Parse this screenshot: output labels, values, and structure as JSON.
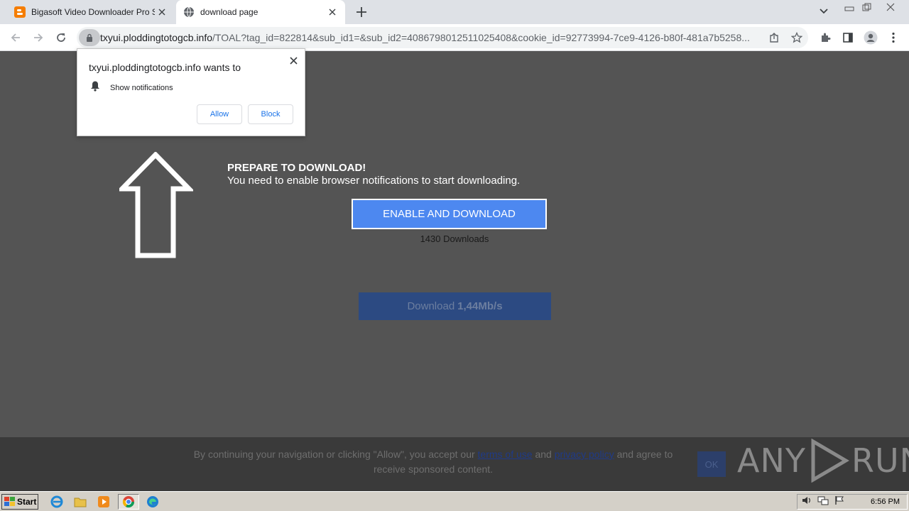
{
  "browser": {
    "tabs": [
      {
        "label": "Bigasoft Video Downloader Pro Serial",
        "active": false
      },
      {
        "label": "download page",
        "active": true
      }
    ],
    "url_host": "txyui.ploddingtotogcb.info",
    "url_rest": "/TOAL?tag_id=822814&sub_id1=&sub_id2=4086798012511025408&cookie_id=92773994-7ce9-4126-b80f-481a7b5258..."
  },
  "permission_popup": {
    "title": "txyui.ploddingtotogcb.info wants to",
    "permission": "Show notifications",
    "allow_label": "Allow",
    "block_label": "Block"
  },
  "content": {
    "heading": "PREPARE TO DOWNLOAD!",
    "subtext": "You need to enable browser notifications to start downloading.",
    "enable_button": "ENABLE AND DOWNLOAD",
    "downloads_count": "1430 Downloads",
    "fake_download_prefix": "Download",
    "fake_download_speed": "1,44Mb/s"
  },
  "consent": {
    "text_before": "By continuing your navigation or clicking \"Allow\", you accept our",
    "terms_link": "terms of use",
    "text_mid": "and",
    "privacy_link": "privacy policy",
    "text_after": "and agree to receive sponsored content.",
    "ok_label": "OK"
  },
  "watermark": {
    "left": "ANY",
    "right": "RUN"
  },
  "taskbar": {
    "start_label": "Start",
    "clock": "6:56 PM"
  },
  "colors": {
    "page_bg": "#545454",
    "enable_button": "#4d88f0",
    "fake_button": "#2c4a82",
    "link_blue": "#1a73e8"
  }
}
